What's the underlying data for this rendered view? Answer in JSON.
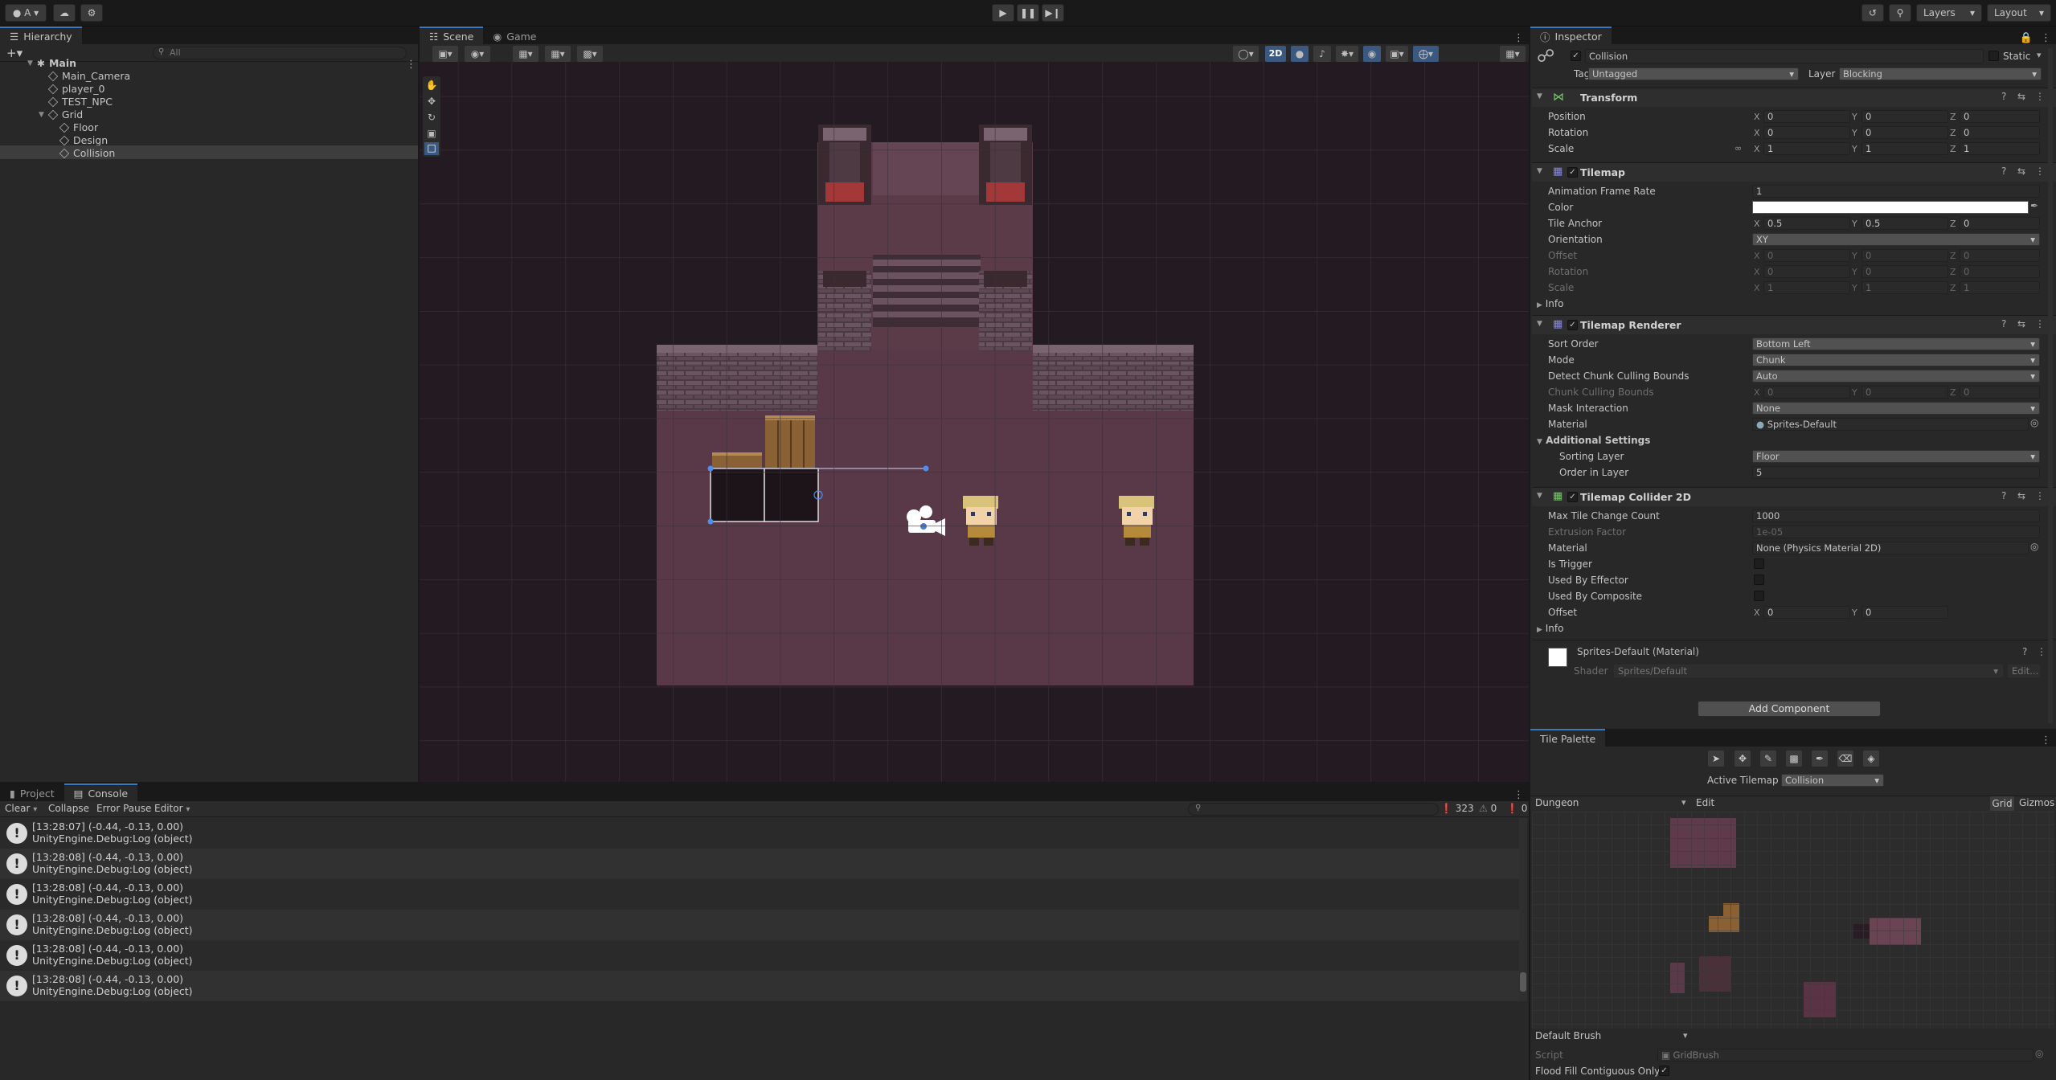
{
  "toolbar": {
    "account": "A",
    "play_icon": "play-icon",
    "pause_icon": "pause-icon",
    "step_icon": "step-icon",
    "layers": "Layers",
    "layout": "Layout"
  },
  "hierarchy": {
    "tab": "Hierarchy",
    "search_placeholder": "All",
    "scene_name": "Main",
    "items": [
      "Main_Camera",
      "player_0",
      "TEST_NPC",
      "Grid",
      "Floor",
      "Design",
      "Collision"
    ]
  },
  "scene": {
    "tabs": [
      "Scene",
      "Game"
    ],
    "btn_2d": "2D"
  },
  "inspector": {
    "tab": "Inspector",
    "object_name": "Collision",
    "static_label": "Static",
    "tag_label": "Tag",
    "tag_value": "Untagged",
    "layer_label": "Layer",
    "layer_value": "Blocking",
    "transform": {
      "title": "Transform",
      "position_label": "Position",
      "position": [
        "0",
        "0",
        "0"
      ],
      "rotation_label": "Rotation",
      "rotation": [
        "0",
        "0",
        "0"
      ],
      "scale_label": "Scale",
      "scale": [
        "1",
        "1",
        "1"
      ]
    },
    "tilemap": {
      "title": "Tilemap",
      "anim_label": "Animation Frame Rate",
      "anim_value": "1",
      "color_label": "Color",
      "anchor_label": "Tile Anchor",
      "anchor": [
        "0.5",
        "0.5",
        "0"
      ],
      "orientation_label": "Orientation",
      "orientation_value": "XY",
      "offset_label": "Offset",
      "offset": [
        "0",
        "0",
        "0"
      ],
      "rotation_label": "Rotation",
      "rotation": [
        "0",
        "0",
        "0"
      ],
      "scale_label": "Scale",
      "scale": [
        "1",
        "1",
        "1"
      ],
      "info": "Info"
    },
    "renderer": {
      "title": "Tilemap Renderer",
      "sort_label": "Sort Order",
      "sort_value": "Bottom Left",
      "mode_label": "Mode",
      "mode_value": "Chunk",
      "detect_label": "Detect Chunk Culling Bounds",
      "detect_value": "Auto",
      "bounds_label": "Chunk Culling Bounds",
      "bounds": [
        "0",
        "0",
        "0"
      ],
      "mask_label": "Mask Interaction",
      "mask_value": "None",
      "material_label": "Material",
      "material_value": "Sprites-Default",
      "additional_label": "Additional Settings",
      "sorting_layer_label": "Sorting Layer",
      "sorting_layer_value": "Floor",
      "order_label": "Order in Layer",
      "order_value": "5"
    },
    "collider": {
      "title": "Tilemap Collider 2D",
      "max_label": "Max Tile Change Count",
      "max_value": "1000",
      "extrusion_label": "Extrusion Factor",
      "extrusion_value": "1e-05",
      "material_label": "Material",
      "material_value": "None (Physics Material 2D)",
      "trigger_label": "Is Trigger",
      "effector_label": "Used By Effector",
      "composite_label": "Used By Composite",
      "offset_label": "Offset",
      "offset": [
        "0",
        "0"
      ],
      "info": "Info"
    },
    "material_block": {
      "name": "Sprites-Default (Material)",
      "shader_label": "Shader",
      "shader_value": "Sprites/Default",
      "edit": "Edit..."
    },
    "add_component": "Add Component"
  },
  "tile_palette": {
    "tab": "Tile Palette",
    "active_label": "Active Tilemap",
    "active_value": "Collision",
    "palette": "Dungeon",
    "edit": "Edit",
    "grid": "Grid",
    "gizmos": "Gizmos",
    "brush": "Default Brush",
    "script_label": "Script",
    "script_value": "GridBrush",
    "flood_label": "Flood Fill Contiguous Only"
  },
  "bottom": {
    "tabs": [
      "Project",
      "Console"
    ],
    "clear": "Clear",
    "collapse": "Collapse",
    "error_pause": "Error Pause",
    "editor": "Editor",
    "count_log": "323",
    "count_warn": "0",
    "count_err": "0",
    "logs": [
      {
        "line1": "[13:28:07] (-0.44, -0.13, 0.00)",
        "line2": "UnityEngine.Debug:Log (object)"
      },
      {
        "line1": "[13:28:08] (-0.44, -0.13, 0.00)",
        "line2": "UnityEngine.Debug:Log (object)"
      },
      {
        "line1": "[13:28:08] (-0.44, -0.13, 0.00)",
        "line2": "UnityEngine.Debug:Log (object)"
      },
      {
        "line1": "[13:28:08] (-0.44, -0.13, 0.00)",
        "line2": "UnityEngine.Debug:Log (object)"
      },
      {
        "line1": "[13:28:08] (-0.44, -0.13, 0.00)",
        "line2": "UnityEngine.Debug:Log (object)"
      },
      {
        "line1": "[13:28:08] (-0.44, -0.13, 0.00)",
        "line2": "UnityEngine.Debug:Log (object)"
      }
    ]
  }
}
